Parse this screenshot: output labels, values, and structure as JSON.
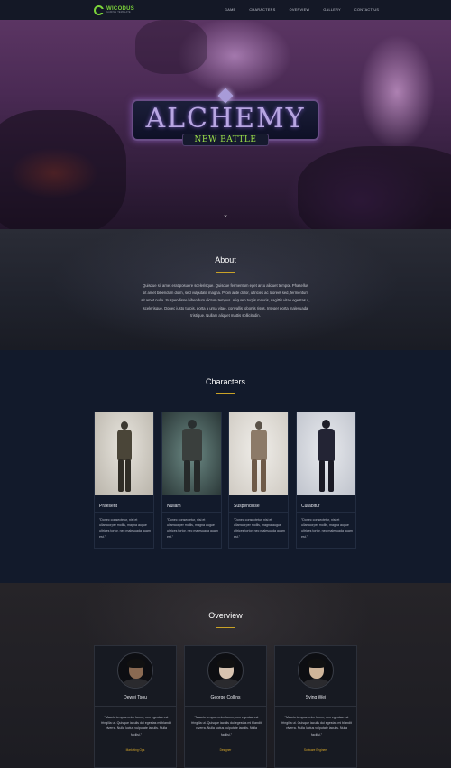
{
  "nav": {
    "logo_name": "WICODUS",
    "logo_sub": "GAMING TEMPLATE",
    "links": [
      "Game",
      "Characters",
      "Overview",
      "Gallery",
      "Contact us"
    ]
  },
  "hero": {
    "title": "ALCHEMY",
    "subtitle": "NEW BATTLE",
    "scroll_icon": "chevron-down-icon"
  },
  "about": {
    "title": "About",
    "text": "Quisque sit amet erat posuere scelerisque. Quisque fermentum eget arcu aliquet tempor. Phasellus sit amet bibendum diam, sed vulputate magna. Proin ante dolor, ultricies ac laoreet sed, fermentum sit amet nulla. Suspendisse bibendum dictum tempus. Aliquam turpis mauris, sagittis vitae egestas a, scelerisque. Donec justo turpis, porta a urna vitae, convallis lobortis risus. Integer porta malesuada tristique. Nullam aliquet mattis sollicitudin."
  },
  "characters": {
    "title": "Characters",
    "items": [
      {
        "name": "Praesent",
        "desc": "\"Donec consectetur, nisi et ullamcorper mollis, magna augue ultrices tortor, nec malesuada quam est.\""
      },
      {
        "name": "Nullam",
        "desc": "\"Donec consectetur, nisi et ullamcorper mollis, magna augue ultrices tortor, nec malesuada quam est.\""
      },
      {
        "name": "Suspendisse",
        "desc": "\"Donec consectetur, nisi et ullamcorper mollis, magna augue ultrices tortor, nec malesuada quam est.\""
      },
      {
        "name": "Curabitur",
        "desc": "\"Donec consectetur, nisi et ullamcorper mollis, magna augue ultrices tortor, nec malesuada quam est.\""
      }
    ]
  },
  "overview": {
    "title": "Overview",
    "people": [
      {
        "name": "Dewei Tsou",
        "quote": "\"Mauris tempus enim lorem, nec egestas est fringilla ut. Quisque iaculis dui egestas mi blandit viverra. Nulla luctus vulputate iaculis. Nulla facilisi.\"",
        "role": "Marketing Ops"
      },
      {
        "name": "George Collins",
        "quote": "\"Mauris tempus enim lorem, nec egestas est fringilla ut. Quisque iaculis dui egestas mi blandit viverra. Nulla luctus vulputate iaculis. Nulla facilisi.\"",
        "role": "Designer"
      },
      {
        "name": "Sying Wei",
        "quote": "\"Mauris tempus enim lorem, nec egestas est fringilla ut. Quisque iaculis dui egestas mi blandit viverra. Nulla luctus vulputate iaculis. Nulla facilisi.\"",
        "role": "Software Engineer"
      }
    ]
  },
  "colors": {
    "accent_green": "#7bd33a",
    "accent_gold": "#c9a227",
    "section_dark": "#121a2b"
  }
}
